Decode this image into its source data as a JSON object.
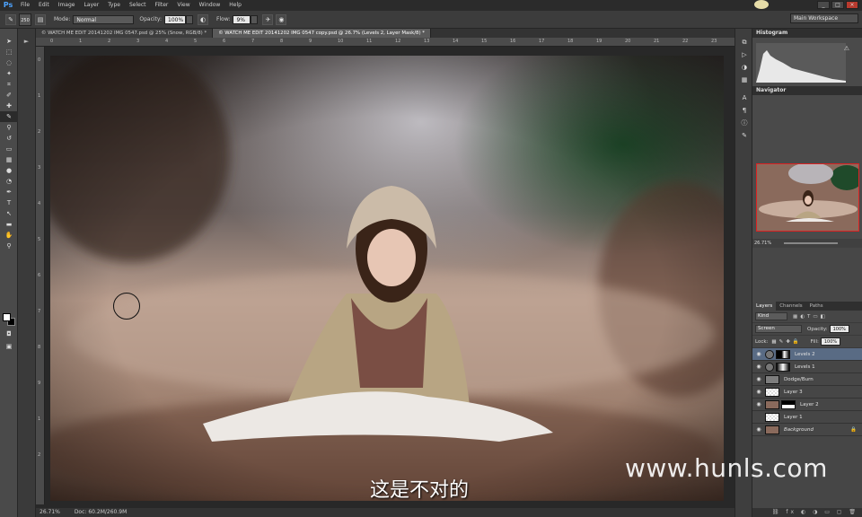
{
  "app": {
    "logo": "Ps",
    "menu": [
      "File",
      "Edit",
      "Image",
      "Layer",
      "Type",
      "Select",
      "Filter",
      "View",
      "Window",
      "Help"
    ],
    "window_controls": [
      "_",
      "□",
      "×"
    ]
  },
  "options_bar": {
    "brush_size": "250",
    "mode_label": "Mode:",
    "mode_value": "Normal",
    "opacity_label": "Opacity:",
    "opacity_value": "100%",
    "flow_label": "Flow:",
    "flow_value": "9%",
    "workspace": "Main Workspace"
  },
  "tabs": [
    {
      "label": "© WATCH ME EDIT 20141202 IMG 0547.psd @ 25% (Snow, RGB/8) *",
      "active": false
    },
    {
      "label": "© WATCH ME EDIT 20141202 IMG 0547 copy.psd @ 26.7% (Levels 2, Layer Mask/8) *",
      "active": true
    }
  ],
  "ruler": {
    "top": [
      "0",
      "1",
      "2",
      "3",
      "4",
      "5",
      "6",
      "7",
      "8",
      "9",
      "10",
      "11",
      "12",
      "13",
      "14",
      "15",
      "16",
      "17",
      "18",
      "19",
      "20",
      "21",
      "22",
      "23"
    ],
    "left": [
      "0",
      "1",
      "2",
      "3",
      "4",
      "5",
      "6",
      "7",
      "8",
      "9",
      "1",
      "2"
    ]
  },
  "status": {
    "zoom": "26.71%",
    "doc": "Doc: 60.2M/260.9M"
  },
  "panels": {
    "histogram_title": "Histogram",
    "navigator_title": "Navigator",
    "navigator_zoom": "26.71%",
    "layer_tabs": [
      "Layers",
      "Channels",
      "Paths"
    ],
    "kind_label": "Kind",
    "blend_mode": "Screen",
    "opacity_label": "Opacity:",
    "opacity_value": "100%",
    "lock_label": "Lock:",
    "fill_label": "Fill:",
    "fill_value": "100%"
  },
  "layers": [
    {
      "name": "Levels 2",
      "selected": true
    },
    {
      "name": "Levels 1",
      "selected": false
    },
    {
      "name": "Dodge/Burn",
      "selected": false
    },
    {
      "name": "Layer 3",
      "selected": false
    },
    {
      "name": "Layer 2",
      "selected": false
    },
    {
      "name": "Layer 1",
      "selected": false
    },
    {
      "name": "Background",
      "selected": false
    }
  ],
  "subtitle": "这是不对的",
  "watermark": "www.hunls.com"
}
